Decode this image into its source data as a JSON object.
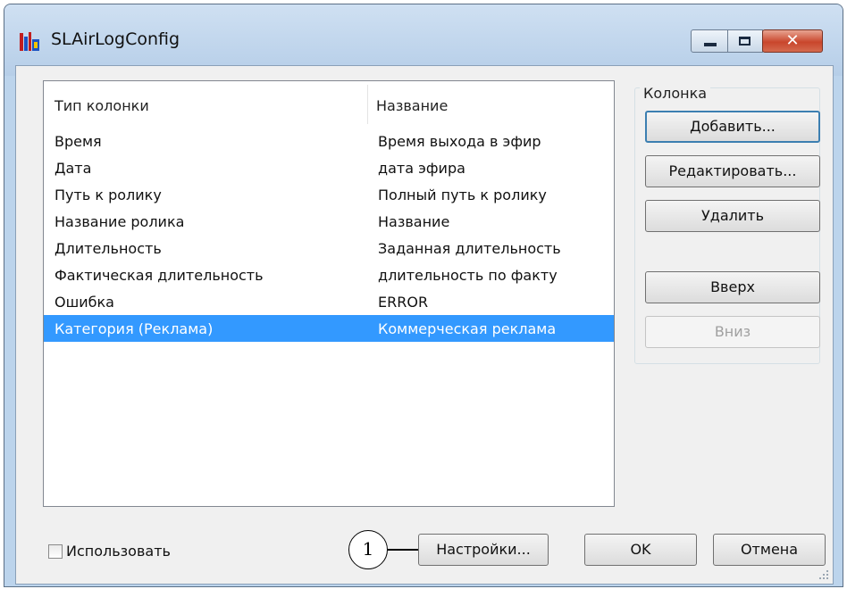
{
  "window": {
    "title": "SLAirLogConfig",
    "close_glyph": "✕"
  },
  "icons": {
    "app": "app-logo-icon",
    "minimize": "minimize-icon",
    "maximize": "maximize-icon",
    "close": "close-icon"
  },
  "list": {
    "headers": [
      "Тип колонки",
      "Название"
    ],
    "rows": [
      {
        "type": "Время",
        "name": "Время выхода в эфир"
      },
      {
        "type": "Дата",
        "name": "дата эфира"
      },
      {
        "type": "Путь к ролику",
        "name": "Полный путь к ролику"
      },
      {
        "type": "Название ролика",
        "name": "Название"
      },
      {
        "type": "Длительность",
        "name": "Заданная длительность"
      },
      {
        "type": "Фактическая длительность",
        "name": "длительность по факту"
      },
      {
        "type": "Ошибка",
        "name": "ERROR"
      },
      {
        "type": "Категория (Реклама)",
        "name": "Коммерческая реклама",
        "selected": true
      }
    ]
  },
  "column_group": {
    "title": "Колонка",
    "add": "Добавить...",
    "edit": "Редактировать...",
    "delete": "Удалить",
    "up": "Вверх",
    "down": "Вниз"
  },
  "footer": {
    "use_label": "Использовать",
    "use_checked": false,
    "settings": "Настройки...",
    "ok": "OK",
    "cancel": "Отмена"
  },
  "callout": "1",
  "colors": {
    "selection": "#3399ff",
    "title_bg": "#bcd4ec",
    "close_btn": "#c9462c"
  }
}
